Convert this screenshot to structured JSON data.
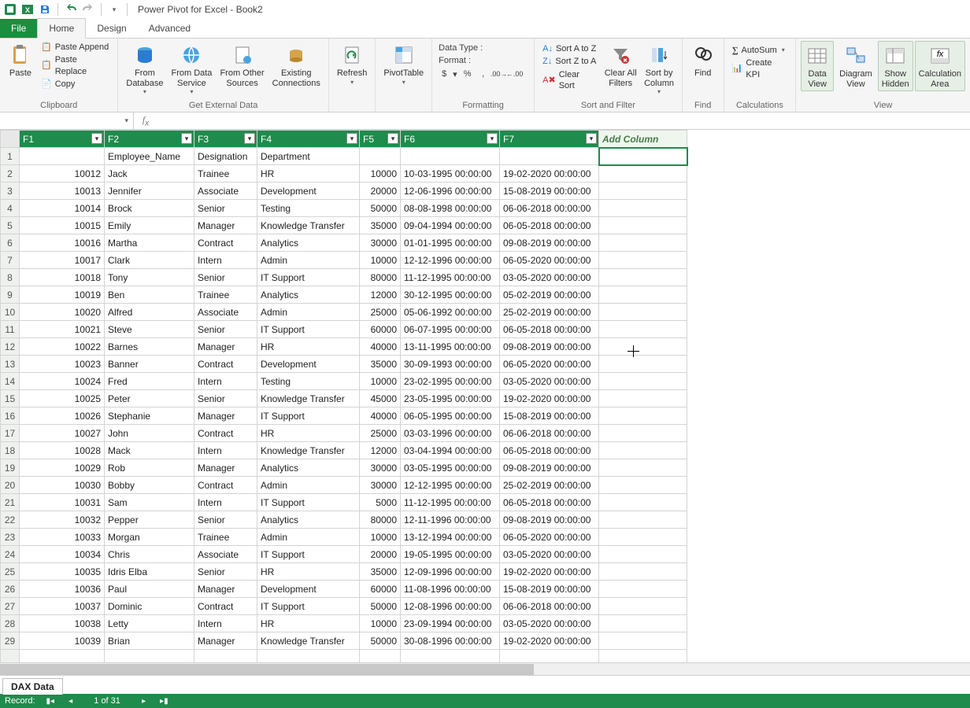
{
  "title": "Power Pivot for Excel - Book2",
  "tabs": {
    "file": "File",
    "home": "Home",
    "design": "Design",
    "advanced": "Advanced"
  },
  "ribbon": {
    "clipboard": {
      "label": "Clipboard",
      "paste": "Paste",
      "paste_append": "Paste Append",
      "paste_replace": "Paste Replace",
      "copy": "Copy"
    },
    "getdata": {
      "label": "Get External Data",
      "from_db": "From\nDatabase",
      "from_ds": "From Data\nService",
      "from_other": "From Other\nSources",
      "existing": "Existing\nConnections"
    },
    "refresh": "Refresh",
    "pivot": "PivotTable",
    "formatting": {
      "label": "Formatting",
      "datatype": "Data Type :",
      "format": "Format :"
    },
    "sortfilter": {
      "label": "Sort and Filter",
      "az": "Sort A to Z",
      "za": "Sort Z to A",
      "clear_sort": "Clear Sort",
      "clear_filters": "Clear All\nFilters",
      "sort_by_col": "Sort by\nColumn"
    },
    "find": {
      "label": "Find",
      "btn": "Find"
    },
    "calc": {
      "label": "Calculations",
      "autosum": "AutoSum",
      "kpi": "Create KPI"
    },
    "view": {
      "label": "View",
      "data": "Data\nView",
      "diagram": "Diagram\nView",
      "hidden": "Show\nHidden",
      "calc_area": "Calculation\nArea"
    }
  },
  "columns": [
    "F1",
    "F2",
    "F3",
    "F4",
    "F5",
    "F6",
    "F7"
  ],
  "add_column": "Add Column",
  "header_row": {
    "f2": "Employee_Name",
    "f3": "Designation",
    "f4": "Department"
  },
  "rows": [
    {
      "f1": "10012",
      "f2": "Jack",
      "f3": "Trainee",
      "f4": "HR",
      "f5": "10000",
      "f6": "10-03-1995 00:00:00",
      "f7": "19-02-2020 00:00:00"
    },
    {
      "f1": "10013",
      "f2": "Jennifer",
      "f3": "Associate",
      "f4": "Development",
      "f5": "20000",
      "f6": "12-06-1996 00:00:00",
      "f7": "15-08-2019 00:00:00"
    },
    {
      "f1": "10014",
      "f2": "Brock",
      "f3": "Senior",
      "f4": "Testing",
      "f5": "50000",
      "f6": "08-08-1998 00:00:00",
      "f7": "06-06-2018 00:00:00"
    },
    {
      "f1": "10015",
      "f2": "Emily",
      "f3": "Manager",
      "f4": "Knowledge Transfer",
      "f5": "35000",
      "f6": "09-04-1994 00:00:00",
      "f7": "06-05-2018 00:00:00"
    },
    {
      "f1": "10016",
      "f2": "Martha",
      "f3": "Contract",
      "f4": "Analytics",
      "f5": "30000",
      "f6": "01-01-1995 00:00:00",
      "f7": "09-08-2019 00:00:00"
    },
    {
      "f1": "10017",
      "f2": "Clark",
      "f3": "Intern",
      "f4": "Admin",
      "f5": "10000",
      "f6": "12-12-1996 00:00:00",
      "f7": "06-05-2020 00:00:00"
    },
    {
      "f1": "10018",
      "f2": "Tony",
      "f3": "Senior",
      "f4": "IT Support",
      "f5": "80000",
      "f6": "11-12-1995 00:00:00",
      "f7": "03-05-2020 00:00:00"
    },
    {
      "f1": "10019",
      "f2": "Ben",
      "f3": "Trainee",
      "f4": "Analytics",
      "f5": "12000",
      "f6": "30-12-1995 00:00:00",
      "f7": "05-02-2019 00:00:00"
    },
    {
      "f1": "10020",
      "f2": "Alfred",
      "f3": "Associate",
      "f4": "Admin",
      "f5": "25000",
      "f6": "05-06-1992 00:00:00",
      "f7": "25-02-2019 00:00:00"
    },
    {
      "f1": "10021",
      "f2": "Steve",
      "f3": "Senior",
      "f4": "IT Support",
      "f5": "60000",
      "f6": "06-07-1995 00:00:00",
      "f7": "06-05-2018 00:00:00"
    },
    {
      "f1": "10022",
      "f2": "Barnes",
      "f3": "Manager",
      "f4": "HR",
      "f5": "40000",
      "f6": "13-11-1995 00:00:00",
      "f7": "09-08-2019 00:00:00"
    },
    {
      "f1": "10023",
      "f2": "Banner",
      "f3": "Contract",
      "f4": "Development",
      "f5": "35000",
      "f6": "30-09-1993 00:00:00",
      "f7": "06-05-2020 00:00:00"
    },
    {
      "f1": "10024",
      "f2": "Fred",
      "f3": "Intern",
      "f4": "Testing",
      "f5": "10000",
      "f6": "23-02-1995 00:00:00",
      "f7": "03-05-2020 00:00:00"
    },
    {
      "f1": "10025",
      "f2": "Peter",
      "f3": "Senior",
      "f4": "Knowledge Transfer",
      "f5": "45000",
      "f6": "23-05-1995 00:00:00",
      "f7": "19-02-2020 00:00:00"
    },
    {
      "f1": "10026",
      "f2": "Stephanie",
      "f3": "Manager",
      "f4": "IT Support",
      "f5": "40000",
      "f6": "06-05-1995 00:00:00",
      "f7": "15-08-2019 00:00:00"
    },
    {
      "f1": "10027",
      "f2": "John",
      "f3": "Contract",
      "f4": "HR",
      "f5": "25000",
      "f6": "03-03-1996 00:00:00",
      "f7": "06-06-2018 00:00:00"
    },
    {
      "f1": "10028",
      "f2": "Mack",
      "f3": "Intern",
      "f4": "Knowledge Transfer",
      "f5": "12000",
      "f6": "03-04-1994 00:00:00",
      "f7": "06-05-2018 00:00:00"
    },
    {
      "f1": "10029",
      "f2": "Rob",
      "f3": "Manager",
      "f4": "Analytics",
      "f5": "30000",
      "f6": "03-05-1995 00:00:00",
      "f7": "09-08-2019 00:00:00"
    },
    {
      "f1": "10030",
      "f2": "Bobby",
      "f3": "Contract",
      "f4": "Admin",
      "f5": "30000",
      "f6": "12-12-1995 00:00:00",
      "f7": "25-02-2019 00:00:00"
    },
    {
      "f1": "10031",
      "f2": "Sam",
      "f3": "Intern",
      "f4": "IT Support",
      "f5": "5000",
      "f6": "11-12-1995 00:00:00",
      "f7": "06-05-2018 00:00:00"
    },
    {
      "f1": "10032",
      "f2": "Pepper",
      "f3": "Senior",
      "f4": "Analytics",
      "f5": "80000",
      "f6": "12-11-1996 00:00:00",
      "f7": "09-08-2019 00:00:00"
    },
    {
      "f1": "10033",
      "f2": "Morgan",
      "f3": "Trainee",
      "f4": "Admin",
      "f5": "10000",
      "f6": "13-12-1994 00:00:00",
      "f7": "06-05-2020 00:00:00"
    },
    {
      "f1": "10034",
      "f2": "Chris",
      "f3": "Associate",
      "f4": "IT Support",
      "f5": "20000",
      "f6": "19-05-1995 00:00:00",
      "f7": "03-05-2020 00:00:00"
    },
    {
      "f1": "10035",
      "f2": "Idris Elba",
      "f3": "Senior",
      "f4": "HR",
      "f5": "35000",
      "f6": "12-09-1996 00:00:00",
      "f7": "19-02-2020 00:00:00"
    },
    {
      "f1": "10036",
      "f2": "Paul",
      "f3": "Manager",
      "f4": "Development",
      "f5": "60000",
      "f6": "11-08-1996 00:00:00",
      "f7": "15-08-2019 00:00:00"
    },
    {
      "f1": "10037",
      "f2": "Dominic",
      "f3": "Contract",
      "f4": "IT Support",
      "f5": "50000",
      "f6": "12-08-1996 00:00:00",
      "f7": "06-06-2018 00:00:00"
    },
    {
      "f1": "10038",
      "f2": "Letty",
      "f3": "Intern",
      "f4": "HR",
      "f5": "10000",
      "f6": "23-09-1994 00:00:00",
      "f7": "03-05-2020 00:00:00"
    },
    {
      "f1": "10039",
      "f2": "Brian",
      "f3": "Manager",
      "f4": "Knowledge Transfer",
      "f5": "50000",
      "f6": "30-08-1996 00:00:00",
      "f7": "19-02-2020 00:00:00"
    }
  ],
  "sheet_tab": "DAX Data",
  "status": {
    "record": "Record:",
    "pos": "1 of 31"
  }
}
